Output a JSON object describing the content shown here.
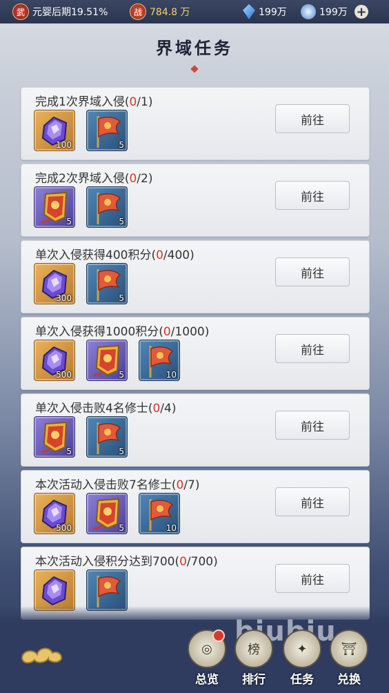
{
  "topbar": {
    "realm_icon": "wu-icon",
    "realm_icon_char": "武",
    "realm_text": "元婴后期19.51%",
    "power_icon": "zhan-icon",
    "power_icon_char": "战",
    "power_text": "784.8 万",
    "gem_text": "199万",
    "spirit_text": "199万",
    "plus_label": "+"
  },
  "page": {
    "title": "界域任务"
  },
  "go_label": "前往",
  "tasks": [
    {
      "title_pre": "完成1次界域入侵(",
      "cur": "0",
      "total": "/1)",
      "items": [
        {
          "kind": "crystal-bag",
          "count": "100"
        },
        {
          "kind": "flag",
          "count": "5"
        }
      ]
    },
    {
      "title_pre": "完成2次界域入侵(",
      "cur": "0",
      "total": "/2)",
      "items": [
        {
          "kind": "banner",
          "count": "5"
        },
        {
          "kind": "flag",
          "count": "5"
        }
      ]
    },
    {
      "title_pre": "单次入侵获得400积分(",
      "cur": "0",
      "total": "/400)",
      "items": [
        {
          "kind": "crystal-bag",
          "count": "300"
        },
        {
          "kind": "flag",
          "count": "5"
        }
      ]
    },
    {
      "title_pre": "单次入侵获得1000积分(",
      "cur": "0",
      "total": "/1000)",
      "items": [
        {
          "kind": "crystal-bag",
          "count": "500"
        },
        {
          "kind": "banner",
          "count": "5"
        },
        {
          "kind": "flag",
          "count": "10"
        }
      ]
    },
    {
      "title_pre": "单次入侵击败4名修士(",
      "cur": "0",
      "total": "/4)",
      "items": [
        {
          "kind": "banner",
          "count": "5"
        },
        {
          "kind": "flag",
          "count": "5"
        }
      ]
    },
    {
      "title_pre": "本次活动入侵击败7名修士(",
      "cur": "0",
      "total": "/7)",
      "items": [
        {
          "kind": "crystal-bag",
          "count": "500"
        },
        {
          "kind": "banner",
          "count": "5"
        },
        {
          "kind": "flag",
          "count": "10"
        }
      ]
    },
    {
      "title_pre": "本次活动入侵积分达到700(",
      "cur": "0",
      "total": "/700)",
      "items": [
        {
          "kind": "crystal",
          "count": ""
        },
        {
          "kind": "flag",
          "count": ""
        }
      ]
    }
  ],
  "nav": [
    {
      "label": "总览",
      "icon": "overview-icon",
      "badge": true
    },
    {
      "label": "排行",
      "icon": "ranking-icon",
      "badge": false
    },
    {
      "label": "任务",
      "icon": "task-icon",
      "badge": false
    },
    {
      "label": "兑换",
      "icon": "exchange-icon",
      "badge": false
    }
  ],
  "watermark": "biubiu",
  "colors": {
    "progress_red": "#d8352a",
    "card_bg": "#eef0f3"
  }
}
